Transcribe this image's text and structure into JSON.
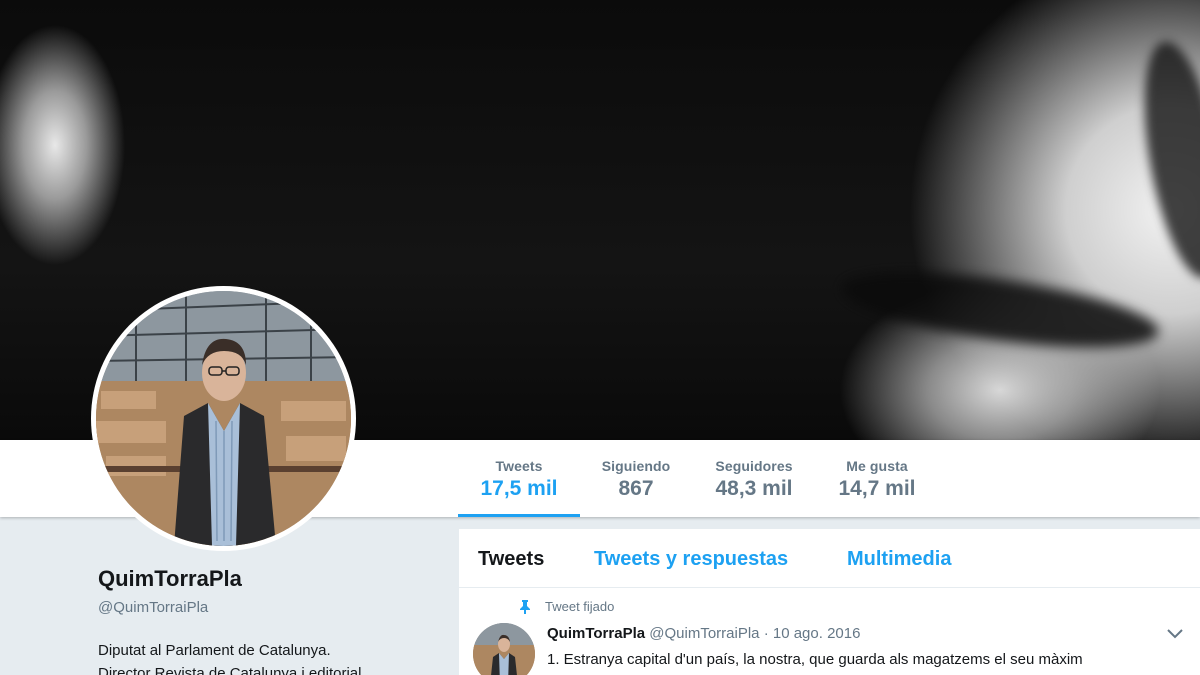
{
  "profile": {
    "name": "QuimTorraPla",
    "handle": "@QuimTorraiPla",
    "bio_line1": "Diputat al Parlament de Catalunya.",
    "bio_line2": "Director Revista de Catalunya i editorial"
  },
  "stats": [
    {
      "label": "Tweets",
      "value": "17,5 mil"
    },
    {
      "label": "Siguiendo",
      "value": "867"
    },
    {
      "label": "Seguidores",
      "value": "48,3 mil"
    },
    {
      "label": "Me gusta",
      "value": "14,7 mil"
    }
  ],
  "tabs": [
    {
      "label": "Tweets"
    },
    {
      "label": "Tweets y respuestas"
    },
    {
      "label": "Multimedia"
    }
  ],
  "tweet": {
    "pinned_label": "Tweet fijado",
    "name": "QuimTorraPla",
    "handle": "@QuimTorraiPla",
    "date": "· 10 ago. 2016",
    "text": "1. Estranya capital d'un país, la nostra, que guarda als magatzems el seu màxim"
  },
  "colors": {
    "accent": "#1da1f2",
    "muted": "#657786",
    "background": "#e6ecf0"
  },
  "icons": [
    "pin-icon",
    "chevron-down-icon"
  ]
}
